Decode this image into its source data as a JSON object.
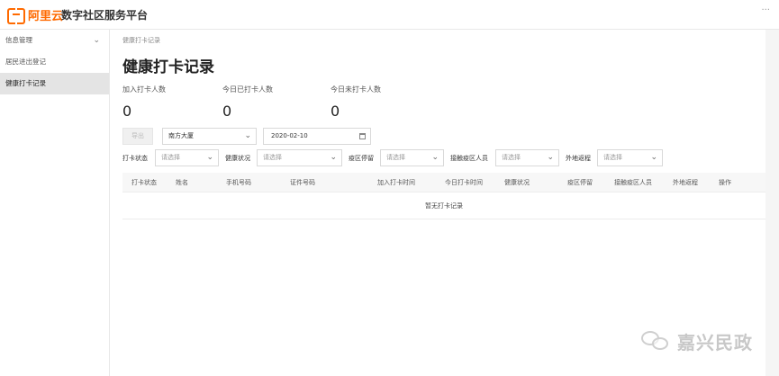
{
  "header": {
    "logo_text": "阿里云",
    "app_title": "数字社区服务平台",
    "more": "..."
  },
  "sidebar": {
    "items": [
      {
        "label": "信息管理"
      },
      {
        "label": "居民进出登记"
      },
      {
        "label": "健康打卡记录"
      }
    ]
  },
  "main": {
    "breadcrumb": "健康打卡记录",
    "title": "健康打卡记录",
    "stats": [
      {
        "label": "加入打卡人数",
        "value": "0"
      },
      {
        "label": "今日已打卡人数",
        "value": "0"
      },
      {
        "label": "今日未打卡人数",
        "value": "0"
      }
    ],
    "toolbar": {
      "export_label": "导出",
      "building_select": "南方大厦",
      "date_value": "2020-02-10"
    },
    "filters": [
      {
        "label": "打卡状态",
        "placeholder": "请选择"
      },
      {
        "label": "健康状况",
        "placeholder": "请选择"
      },
      {
        "label": "疫区停留",
        "placeholder": "请选择"
      },
      {
        "label": "接触疫区人员",
        "placeholder": "请选择"
      },
      {
        "label": "外地返程",
        "placeholder": "请选择"
      }
    ],
    "table": {
      "columns": [
        "打卡状态",
        "姓名",
        "手机号码",
        "证件号码",
        "加入打卡时间",
        "今日打卡时间",
        "健康状况",
        "疫区停留",
        "接触疫区人员",
        "外地返程",
        "操作"
      ],
      "empty_text": "暂无打卡记录"
    }
  },
  "watermark": {
    "text": "嘉兴民政"
  },
  "colors": {
    "brand": "#ff6a00",
    "sidebar_active": "#e4e4e4"
  }
}
